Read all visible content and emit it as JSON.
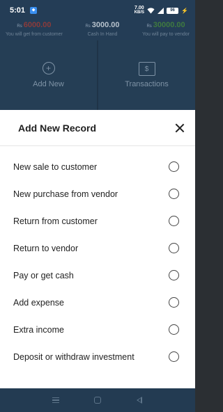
{
  "status_bar": {
    "time": "5:01",
    "net_speed_value": "7.00",
    "net_speed_unit": "KB/S",
    "battery": "96"
  },
  "summary": {
    "currency": "Rs",
    "items": [
      {
        "amount": "6000.00",
        "label": "You will get from customer",
        "color": "#8a3b3b"
      },
      {
        "amount": "3000.00",
        "label": "Cash In Hand",
        "color": "#b7c2cc"
      },
      {
        "amount": "30000.00",
        "label": "You will pay to vendor",
        "color": "#3f7a3f"
      }
    ]
  },
  "tiles": {
    "add_new": "Add New",
    "transactions": "Transactions"
  },
  "sheet": {
    "title": "Add New Record",
    "options": [
      {
        "label": "New sale to customer"
      },
      {
        "label": "New purchase from vendor"
      },
      {
        "label": "Return from customer"
      },
      {
        "label": "Return to vendor"
      },
      {
        "label": "Pay or get cash"
      },
      {
        "label": "Add expense"
      },
      {
        "label": "Extra income"
      },
      {
        "label": "Deposit or withdraw investment"
      }
    ]
  },
  "colors": {
    "app_bar": "#243d56",
    "sheet_bg": "#ffffff",
    "nav_bar": "#233b52"
  }
}
